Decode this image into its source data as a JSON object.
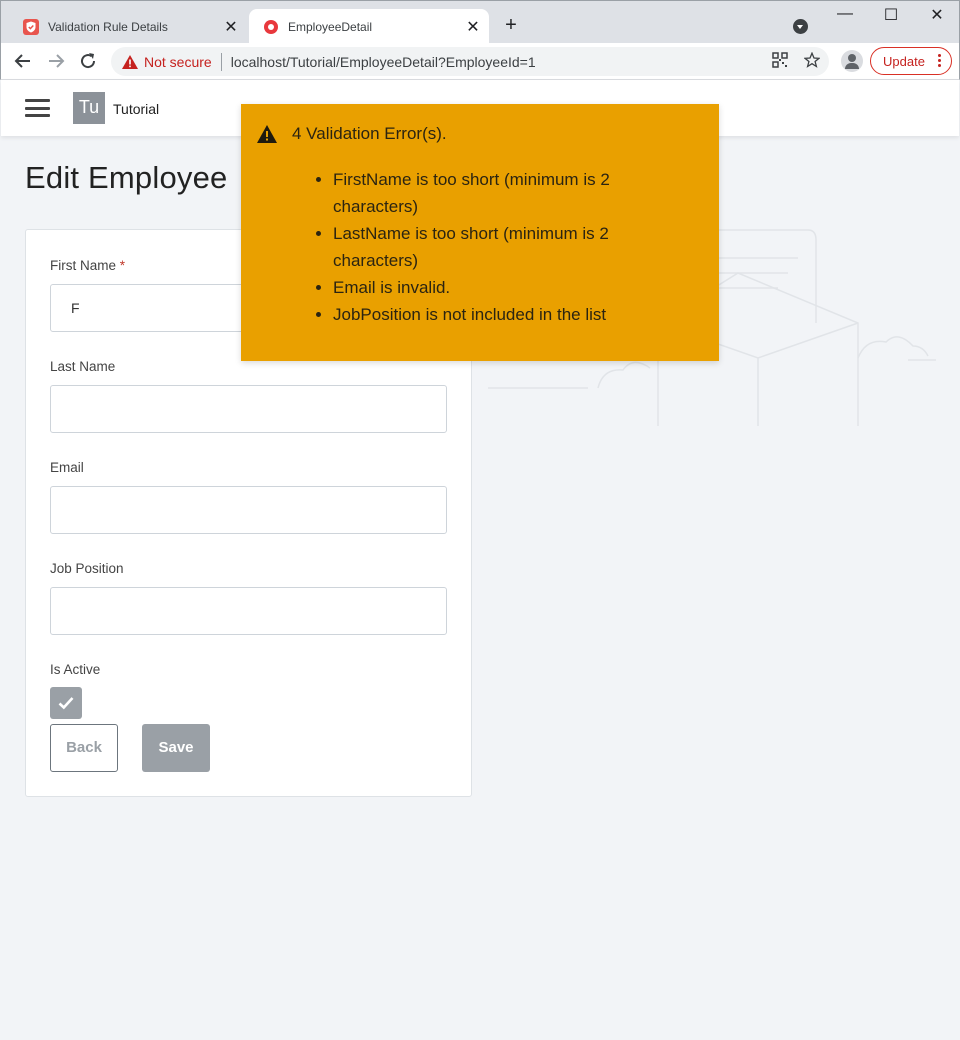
{
  "browser": {
    "tabs": [
      {
        "title": "Validation Rule Details",
        "active": false
      },
      {
        "title": "EmployeeDetail",
        "active": true
      }
    ],
    "new_tab_symbol": "+",
    "close_symbol": "✕",
    "security_label": "Not secure",
    "url": "localhost/Tutorial/EmployeeDetail?EmployeeId=1",
    "update_label": "Update",
    "window_controls": {
      "minimize": "—",
      "maximize": "☐",
      "close": "✕"
    }
  },
  "app": {
    "logo_text": "Tu",
    "brand": "Tutorial"
  },
  "page": {
    "title": "Edit Employee",
    "form": {
      "first_name_label": "First Name",
      "required_marker": "*",
      "first_name_value": "F",
      "last_name_label": "Last Name",
      "last_name_value": "",
      "email_label": "Email",
      "email_value": "",
      "job_position_label": "Job Position",
      "job_position_value": "",
      "is_active_label": "Is Active",
      "is_active_checked": true,
      "back_label": "Back",
      "save_label": "Save"
    }
  },
  "toast": {
    "heading": "4 Validation Error(s).",
    "errors": [
      "FirstName is too short (minimum is 2 characters)",
      "LastName is too short (minimum is 2 characters)",
      "Email is invalid.",
      "JobPosition is not included in the list"
    ],
    "color": "#e9a000"
  },
  "colors": {
    "accent_disabled": "#9aa0a6",
    "insecure": "#c5221f",
    "page_bg": "#f2f4f7"
  }
}
